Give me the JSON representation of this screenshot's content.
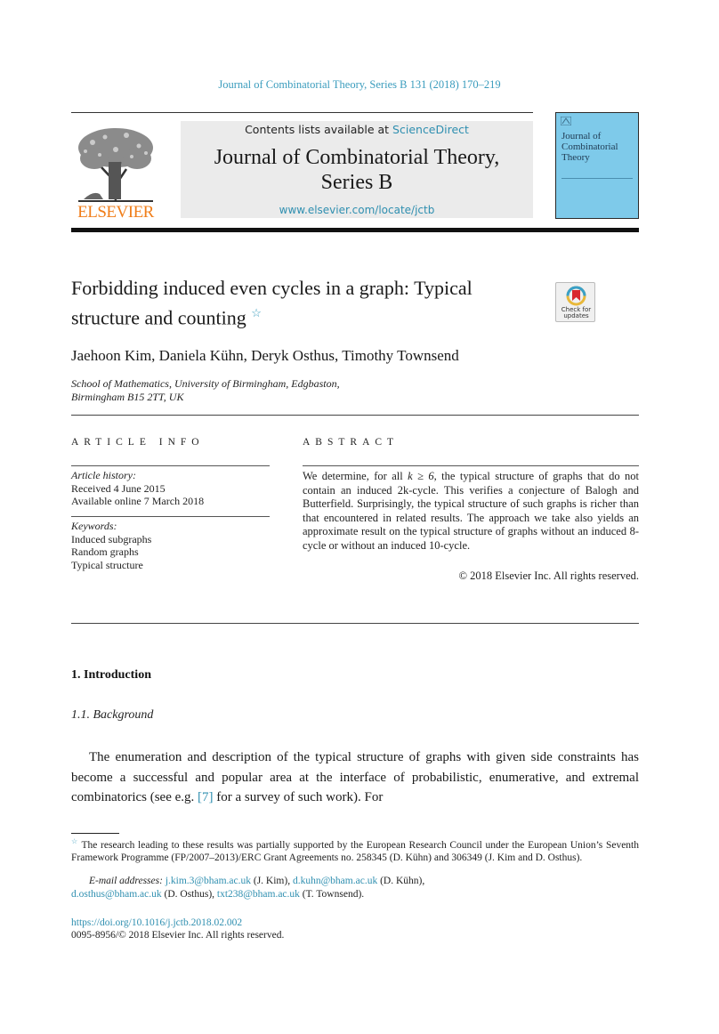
{
  "running_head": "Journal of Combinatorial Theory, Series B 131 (2018) 170–219",
  "header": {
    "contents_prefix": "Contents lists available at ",
    "contents_link": "ScienceDirect",
    "journal_title_line1": "Journal of Combinatorial Theory,",
    "journal_title_line2": "Series B",
    "journal_url": "www.elsevier.com/locate/jctb",
    "publisher_logo_text": "ELSEVIER",
    "cover_title_lines": [
      "Journal of",
      "Combinatorial",
      "Theory"
    ],
    "colors": {
      "link": "#3a9cbd",
      "elsevier_orange": "#f07e1a",
      "cover_blue": "#7ecaea",
      "header_band": "#ebebeb"
    }
  },
  "article": {
    "title": "Forbidding induced even cycles in a graph: Typical structure and counting",
    "title_footnote_marker": "☆",
    "check_updates_label_1": "Check for",
    "check_updates_label_2": "updates",
    "authors": "Jaehoon Kim, Daniela Kühn, Deryk Osthus, Timothy Townsend",
    "affiliation_line1": "School of Mathematics, University of Birmingham, Edgbaston,",
    "affiliation_line2": "Birmingham B15 2TT, UK"
  },
  "article_info": {
    "label": "ARTICLE INFO",
    "history_label": "Article history:",
    "received": "Received 4 June 2015",
    "available_online": "Available online 7 March 2018",
    "keywords_label": "Keywords:",
    "keywords": [
      "Induced subgraphs",
      "Random graphs",
      "Typical structure"
    ]
  },
  "abstract": {
    "label": "ABSTRACT",
    "text_part1": "We determine, for all ",
    "math1": "k ≥ 6",
    "text_part2": ", the typical structure of graphs that do not contain an induced ",
    "math2": "2k",
    "text_part3": "-cycle. This verifies a conjecture of Balogh and Butterfield. Surprisingly, the typical structure of such graphs is richer than that encountered in related results. The approach we take also yields an approximate result on the typical structure of graphs without an induced 8-cycle or without an induced 10-cycle.",
    "copyright": "© 2018 Elsevier Inc. All rights reserved."
  },
  "body": {
    "section_heading": "1.  Introduction",
    "subsection_heading": "1.1.  Background",
    "para_part1": "The enumeration and description of the typical structure of graphs with given side constraints has become a successful and popular area at the interface of probabilistic, enumerative, and extremal combinatorics (see e.g. ",
    "citation": "[7]",
    "para_part2": " for a survey of such work). For"
  },
  "footnotes": {
    "star_marker": "☆",
    "funding": " The research leading to these results was partially supported by the European Research Council under the European Union’s Seventh Framework Programme (FP/2007–2013)/ERC Grant Agreements no. 258345 (D. Kühn) and 306349 (J. Kim and D. Osthus).",
    "email_label": "E-mail addresses:",
    "emails": [
      {
        "address": "j.kim.3@bham.ac.uk",
        "name": " (J. Kim), "
      },
      {
        "address": "d.kuhn@bham.ac.uk",
        "name": " (D. Kühn), "
      },
      {
        "address": "d.osthus@bham.ac.uk",
        "name": " (D. Osthus), "
      },
      {
        "address": "txt238@bham.ac.uk",
        "name": " (T. Townsend)."
      }
    ]
  },
  "footer": {
    "doi": "https://doi.org/10.1016/j.jctb.2018.02.002",
    "issn_line": "0095-8956/© 2018 Elsevier Inc. All rights reserved."
  }
}
